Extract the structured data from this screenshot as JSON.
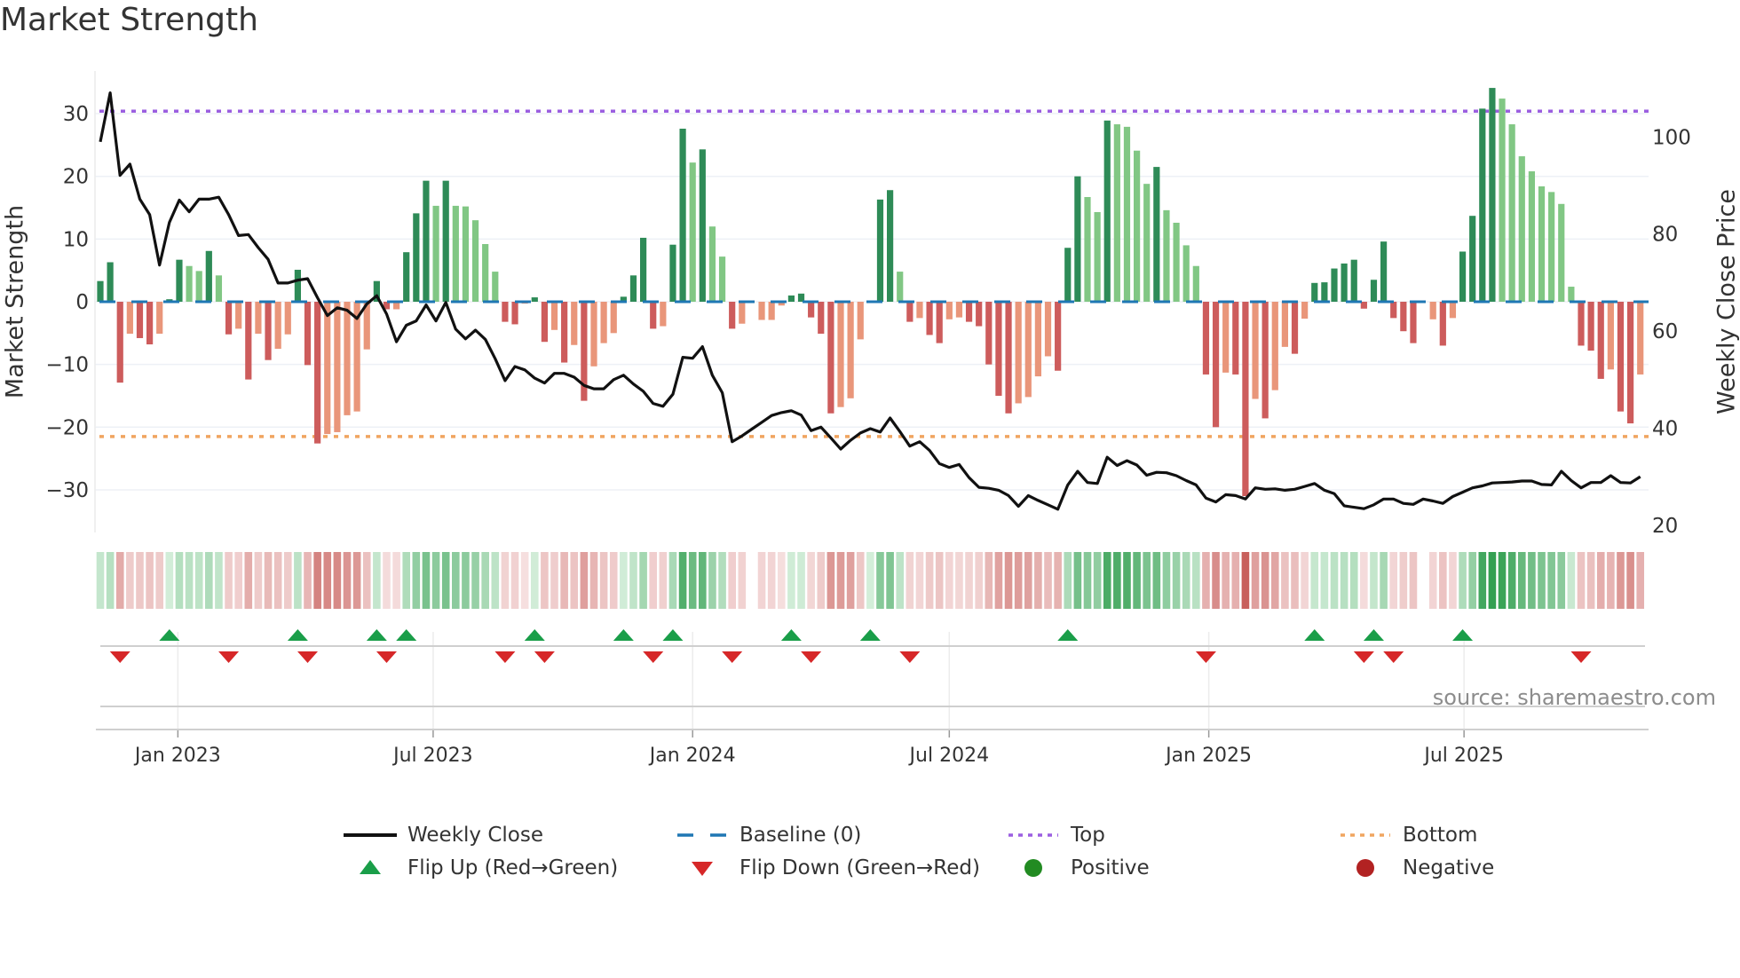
{
  "title": "Market Strength",
  "source_note": "source: sharemaestro.com",
  "colors": {
    "strong_positive": "#2e8b57",
    "weak_positive": "#81c784",
    "strong_negative": "#cd5c5c",
    "weak_negative": "#e9967a",
    "baseline": "#1f77b4",
    "top": "#9b5fe0",
    "bottom": "#f0a560",
    "close": "#111111",
    "flip_up": "#1a9e49",
    "flip_down": "#d62728",
    "positive": "#228b22",
    "negative": "#b22222"
  },
  "legend": [
    {
      "label": "Weekly Close",
      "icon": "solid-line-icon"
    },
    {
      "label": "Baseline (0)",
      "icon": "dashed-line-icon"
    },
    {
      "label": "Top",
      "icon": "dotted-line-purple-icon"
    },
    {
      "label": "Bottom",
      "icon": "dotted-line-orange-icon"
    },
    {
      "label": "Flip Up (Red→Green)",
      "icon": "triangle-up-icon"
    },
    {
      "label": "Flip Down (Green→Red)",
      "icon": "triangle-down-icon"
    },
    {
      "label": "Positive",
      "icon": "green-circle-icon"
    },
    {
      "label": "Negative",
      "icon": "red-circle-icon"
    }
  ],
  "chart_data": {
    "type": "bar",
    "title": "Market Strength",
    "frequency": "weekly",
    "start_date": "2022-11-07",
    "y_left": {
      "label": "Market Strength",
      "lim": [
        -36.8,
        36.8
      ],
      "ticks": [
        -30,
        -20,
        -10,
        0,
        10,
        20,
        30
      ],
      "tick_labels": [
        "−30",
        "−20",
        "−10",
        "0",
        "10",
        "20",
        "30"
      ]
    },
    "y_right": {
      "label": "Weekly Close Price",
      "lim": [
        18.5,
        113.6
      ],
      "ticks": [
        20,
        40,
        60,
        80,
        100
      ],
      "tick_labels": [
        "20",
        "40",
        "60",
        "80",
        "100"
      ]
    },
    "x_ticks": [
      {
        "date": "2023-01-01",
        "label": "Jan 2023"
      },
      {
        "date": "2023-07-01",
        "label": "Jul 2023"
      },
      {
        "date": "2024-01-01",
        "label": "Jan 2024"
      },
      {
        "date": "2024-07-01",
        "label": "Jul 2024"
      },
      {
        "date": "2025-01-01",
        "label": "Jan 2025"
      },
      {
        "date": "2025-07-01",
        "label": "Jul 2025"
      }
    ],
    "top_level": 30.4,
    "bottom_level": -21.5,
    "baseline": 0,
    "grid": true,
    "legend_position": "bottom",
    "series": [
      {
        "name": "Market Strength",
        "type": "bar",
        "axis": "left",
        "values": [
          3.3,
          6.3,
          -12.9,
          -5.1,
          -5.8,
          -6.8,
          -5.1,
          0.4,
          6.7,
          5.7,
          4.9,
          8.1,
          4.2,
          -5.2,
          -4.3,
          -12.4,
          -5.1,
          -9.3,
          -7.5,
          -5.2,
          5.1,
          -10.1,
          -22.6,
          -21.1,
          -20.8,
          -18.1,
          -17.5,
          -7.6,
          3.3,
          -1.2,
          -1.2,
          7.9,
          14.1,
          19.3,
          15.3,
          19.3,
          15.3,
          15.2,
          13.0,
          9.2,
          4.8,
          -3.2,
          -3.6,
          -0.3,
          0.7,
          -6.4,
          -4.5,
          -9.7,
          -6.9,
          -15.8,
          -10.3,
          -6.6,
          -5.0,
          0.8,
          4.2,
          10.2,
          -4.3,
          -3.9,
          9.1,
          27.6,
          22.2,
          24.3,
          12.0,
          7.2,
          -4.3,
          -3.5,
          0,
          -2.9,
          -2.9,
          -0.6,
          1.0,
          1.3,
          -2.5,
          -5.1,
          -17.8,
          -16.8,
          -15.4,
          -6.0,
          0.2,
          16.3,
          17.8,
          4.8,
          -3.2,
          -2.6,
          -5.3,
          -6.6,
          -2.8,
          -2.5,
          -3.2,
          -3.9,
          -10.0,
          -15.0,
          -17.8,
          -16.2,
          -15.2,
          -11.9,
          -8.7,
          -11.0,
          8.6,
          20.0,
          16.7,
          14.3,
          28.9,
          28.3,
          27.9,
          24.1,
          18.8,
          21.5,
          14.6,
          12.6,
          9.0,
          5.7,
          -11.6,
          -20.0,
          -11.3,
          -11.6,
          -31.0,
          -15.5,
          -18.6,
          -14.1,
          -7.2,
          -8.3,
          -2.7,
          3.0,
          3.1,
          5.3,
          6.1,
          6.7,
          -1.1,
          3.5,
          9.6,
          -2.6,
          -4.7,
          -6.6,
          0,
          -2.8,
          -7.0,
          -2.6,
          8.0,
          13.7,
          30.8,
          34.1,
          32.4,
          28.3,
          23.2,
          20.8,
          18.4,
          17.5,
          15.6,
          2.4,
          -7.0,
          -7.8,
          -12.3,
          -10.8,
          -17.5,
          -19.4,
          -11.6
        ]
      },
      {
        "name": "Weekly Close",
        "type": "line",
        "axis": "right",
        "values": [
          99.0,
          109.1,
          92.1,
          94.4,
          87.2,
          84.0,
          73.6,
          82.4,
          87.0,
          84.6,
          87.2,
          87.2,
          87.6,
          84.0,
          79.7,
          79.9,
          77.2,
          74.8,
          69.9,
          69.9,
          70.5,
          70.8,
          66.9,
          63.2,
          64.8,
          64.3,
          62.6,
          65.6,
          67.3,
          63.5,
          57.8,
          61.2,
          62.1,
          65.4,
          62.1,
          65.9,
          60.4,
          58.4,
          60.2,
          58.3,
          54.3,
          49.8,
          52.7,
          52.0,
          50.3,
          49.3,
          51.3,
          51.3,
          50.5,
          48.8,
          48.1,
          48.1,
          50.0,
          50.9,
          49.1,
          47.6,
          45.1,
          44.5,
          47.0,
          54.6,
          54.4,
          56.8,
          50.9,
          47.3,
          37.2,
          38.4,
          39.8,
          41.2,
          42.6,
          43.2,
          43.6,
          42.7,
          39.5,
          40.2,
          38.0,
          35.7,
          37.5,
          39.0,
          39.9,
          39.2,
          42.1,
          39.3,
          36.3,
          37.2,
          35.4,
          32.7,
          31.9,
          32.5,
          29.8,
          27.8,
          27.6,
          27.2,
          26.1,
          23.9,
          26.1,
          25.1,
          24.2,
          23.3,
          28.3,
          31.1,
          28.8,
          28.6,
          34.0,
          32.3,
          33.3,
          32.4,
          30.3,
          30.9,
          30.8,
          30.2,
          29.2,
          28.3,
          25.6,
          24.8,
          26.3,
          26.1,
          25.4,
          27.7,
          27.4,
          27.5,
          27.2,
          27.4,
          28.0,
          28.6,
          27.2,
          26.5,
          24.0,
          23.7,
          23.4,
          24.2,
          25.4,
          25.4,
          24.5,
          24.3,
          25.4,
          25.0,
          24.5,
          25.9,
          26.8,
          27.7,
          28.1,
          28.7,
          28.8,
          28.9,
          29.1,
          29.1,
          28.4,
          28.3,
          31.1,
          29.2,
          27.7,
          28.8,
          28.8,
          30.2,
          28.8,
          28.7,
          30.0
        ]
      }
    ]
  }
}
